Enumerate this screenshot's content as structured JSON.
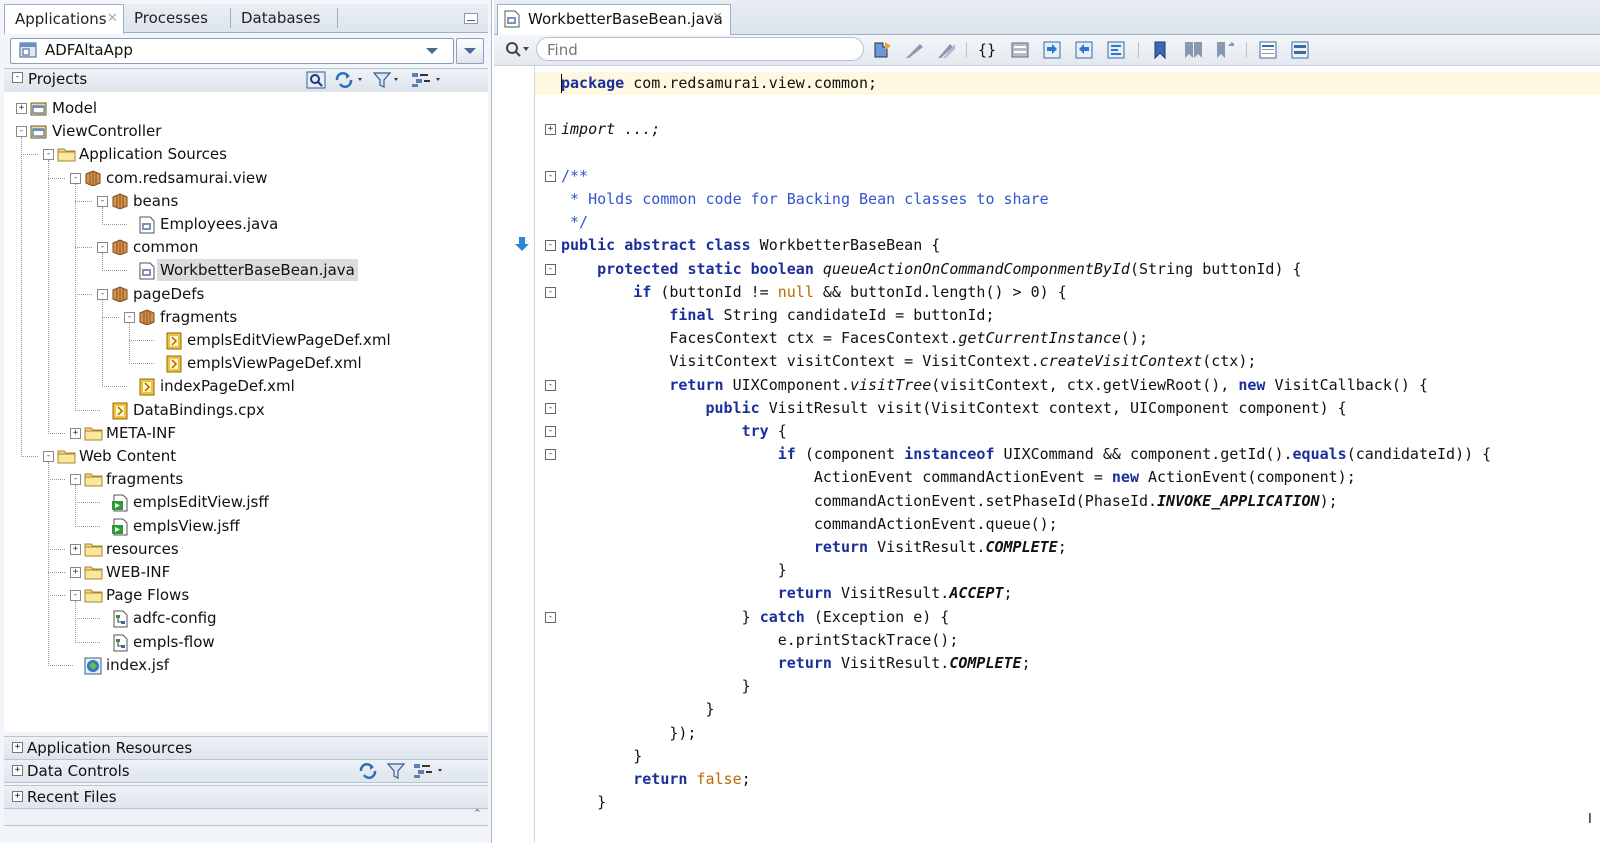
{
  "left_panel": {
    "tabs": [
      {
        "label": "Applications",
        "active": true
      },
      {
        "label": "Processes",
        "active": false
      },
      {
        "label": "Databases",
        "active": false
      }
    ],
    "app_selector": {
      "value": "ADFAltaApp"
    },
    "projects_header": {
      "label": "Projects"
    },
    "tree": [
      {
        "label": "Model",
        "level": 0,
        "icon": "project-icon",
        "expander": "+"
      },
      {
        "label": "ViewController",
        "level": 0,
        "icon": "project-icon",
        "expander": "-"
      },
      {
        "label": "Application Sources",
        "level": 1,
        "icon": "folder-icon",
        "expander": "-"
      },
      {
        "label": "com.redsamurai.view",
        "level": 2,
        "icon": "package-icon",
        "expander": "-"
      },
      {
        "label": "beans",
        "level": 3,
        "icon": "package-icon",
        "expander": "-"
      },
      {
        "label": "Employees.java",
        "level": 4,
        "icon": "java-file-icon",
        "expander": ""
      },
      {
        "label": "common",
        "level": 3,
        "icon": "package-icon",
        "expander": "-"
      },
      {
        "label": "WorkbetterBaseBean.java",
        "level": 4,
        "icon": "java-file-icon",
        "expander": "",
        "selected": true
      },
      {
        "label": "pageDefs",
        "level": 3,
        "icon": "package-icon",
        "expander": "-"
      },
      {
        "label": "fragments",
        "level": 4,
        "icon": "package-icon",
        "expander": "-"
      },
      {
        "label": "emplsEditViewPageDef.xml",
        "level": 5,
        "icon": "xml-file-icon",
        "expander": ""
      },
      {
        "label": "emplsViewPageDef.xml",
        "level": 5,
        "icon": "xml-file-icon",
        "expander": ""
      },
      {
        "label": "indexPageDef.xml",
        "level": 4,
        "icon": "xml-file-icon",
        "expander": ""
      },
      {
        "label": "DataBindings.cpx",
        "level": 3,
        "icon": "xml-file-icon",
        "expander": ""
      },
      {
        "label": "META-INF",
        "level": 2,
        "icon": "folder-icon",
        "expander": "+"
      },
      {
        "label": "Web Content",
        "level": 1,
        "icon": "folder-icon",
        "expander": "-"
      },
      {
        "label": "fragments",
        "level": 2,
        "icon": "folder-icon",
        "expander": "-"
      },
      {
        "label": "emplsEditView.jsff",
        "level": 3,
        "icon": "jsff-file-icon",
        "expander": ""
      },
      {
        "label": "emplsView.jsff",
        "level": 3,
        "icon": "jsff-file-icon",
        "expander": ""
      },
      {
        "label": "resources",
        "level": 2,
        "icon": "folder-icon",
        "expander": "+"
      },
      {
        "label": "WEB-INF",
        "level": 2,
        "icon": "folder-icon",
        "expander": "+"
      },
      {
        "label": "Page Flows",
        "level": 2,
        "icon": "folder-icon",
        "expander": "-"
      },
      {
        "label": "adfc-config",
        "level": 3,
        "icon": "task-flow-icon",
        "expander": ""
      },
      {
        "label": "empls-flow",
        "level": 3,
        "icon": "task-flow-icon",
        "expander": ""
      },
      {
        "label": "index.jsf",
        "level": 2,
        "icon": "jsf-page-icon",
        "expander": ""
      }
    ],
    "accordions": [
      {
        "label": "Application Resources"
      },
      {
        "label": "Data Controls"
      },
      {
        "label": "Recent Files"
      }
    ]
  },
  "editor": {
    "tab": {
      "label": "WorkbetterBaseBean.java"
    },
    "find": {
      "placeholder": "Find"
    },
    "code_lines": [
      "package com.redsamurai.view.common;",
      "",
      "import ...;",
      "",
      "/**",
      " * Holds common code for Backing Bean classes to share",
      " */",
      "public abstract class WorkbetterBaseBean {",
      "    protected static boolean queueActionOnCommandComponmentById(String buttonId) {",
      "        if (buttonId != null && buttonId.length() > 0) {",
      "            final String candidateId = buttonId;",
      "            FacesContext ctx = FacesContext.getCurrentInstance();",
      "            VisitContext visitContext = VisitContext.createVisitContext(ctx);",
      "            return UIXComponent.visitTree(visitContext, ctx.getViewRoot(), new VisitCallback() {",
      "                public VisitResult visit(VisitContext context, UIComponent component) {",
      "                    try {",
      "                        if (component instanceof UIXCommand && component.getId().equals(candidateId)) {",
      "                            ActionEvent commandActionEvent = new ActionEvent(component);",
      "                            commandActionEvent.setPhaseId(PhaseId.INVOKE_APPLICATION);",
      "                            commandActionEvent.queue();",
      "                            return VisitResult.COMPLETE;",
      "                        }",
      "                        return VisitResult.ACCEPT;",
      "                    } catch (Exception e) {",
      "                        e.printStackTrace();",
      "                        return VisitResult.COMPLETE;",
      "                    }",
      "                }",
      "            });",
      "        }",
      "        return false;",
      "    }"
    ]
  },
  "colors": {
    "keyword": "#1b2f9b",
    "comment": "#3355cc",
    "literal": "#b76b00",
    "current_line": "#fff8e1"
  }
}
